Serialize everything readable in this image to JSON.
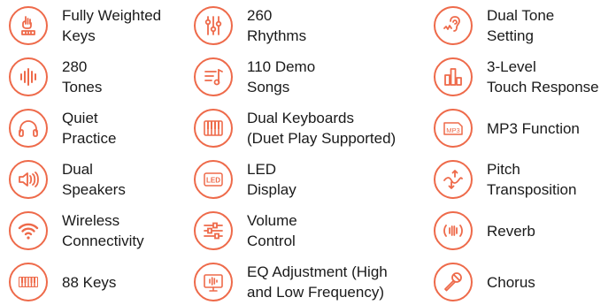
{
  "accent_color": "#ee6a4a",
  "features": [
    {
      "icon": "hand-keys-icon",
      "lines": [
        "Fully Weighted",
        "Keys"
      ]
    },
    {
      "icon": "sliders-icon",
      "lines": [
        "260",
        "Rhythms"
      ]
    },
    {
      "icon": "ear-icon",
      "lines": [
        "Dual Tone",
        "Setting"
      ]
    },
    {
      "icon": "waveform-icon",
      "lines": [
        "280",
        "Tones"
      ]
    },
    {
      "icon": "music-list-icon",
      "lines": [
        "110 Demo",
        "Songs"
      ]
    },
    {
      "icon": "bar-levels-icon",
      "lines": [
        "3-Level",
        "Touch Response"
      ]
    },
    {
      "icon": "headphones-icon",
      "lines": [
        "Quiet",
        "Practice"
      ]
    },
    {
      "icon": "keyboard-icon",
      "lines": [
        "Dual Keyboards",
        "(Duet Play Supported)"
      ]
    },
    {
      "icon": "mp3-file-icon",
      "icon_text": "MP3",
      "lines": [
        "MP3 Function"
      ]
    },
    {
      "icon": "speaker-icon",
      "lines": [
        "Dual",
        "Speakers"
      ]
    },
    {
      "icon": "led-display-icon",
      "icon_text": "LED",
      "lines": [
        "LED",
        "Display"
      ]
    },
    {
      "icon": "pitch-arrows-icon",
      "lines": [
        "Pitch",
        "Transposition"
      ]
    },
    {
      "icon": "wifi-icon",
      "lines": [
        "Wireless",
        "Connectivity"
      ]
    },
    {
      "icon": "volume-sliders-icon",
      "lines": [
        "Volume",
        "Control"
      ]
    },
    {
      "icon": "reverb-icon",
      "lines": [
        "Reverb"
      ]
    },
    {
      "icon": "piano-keys-icon",
      "lines": [
        "88 Keys"
      ]
    },
    {
      "icon": "eq-monitor-icon",
      "lines": [
        "EQ Adjustment (High",
        "and Low Frequency)"
      ]
    },
    {
      "icon": "microphone-icon",
      "lines": [
        "Chorus"
      ]
    }
  ]
}
